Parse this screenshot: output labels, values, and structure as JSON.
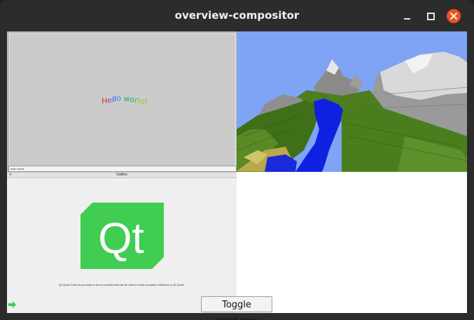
{
  "window": {
    "title": "overview-compositor"
  },
  "hello_client": {
    "letters": [
      {
        "ch": "H",
        "color": "#c0392b"
      },
      {
        "ch": "e",
        "color": "#8e44ad"
      },
      {
        "ch": "l",
        "color": "#2f4fd0"
      },
      {
        "ch": "l",
        "color": "#2f4fd0"
      },
      {
        "ch": "o",
        "color": "#1e90ff"
      },
      {
        "ch": " ",
        "color": "#000000"
      },
      {
        "ch": "w",
        "color": "#27ae60"
      },
      {
        "ch": "o",
        "color": "#27ae60"
      },
      {
        "ch": "r",
        "color": "#2ecc71"
      },
      {
        "ch": "l",
        "color": "#7fbf2a"
      },
      {
        "ch": "d",
        "color": "#9acd32"
      },
      {
        "ch": "!",
        "color": "#a0b020"
      }
    ],
    "input_text": "hello world"
  },
  "gallery_client": {
    "title": "Gallery",
    "menu_icon": "hamburger-icon",
    "caption": "Qt Quick Controls provides a set of controls that can be used to build complete interfaces in Qt Quick.",
    "logo_text": "Qt",
    "logo_color": "#41cd52"
  },
  "toggle": {
    "label": "Toggle overview"
  }
}
